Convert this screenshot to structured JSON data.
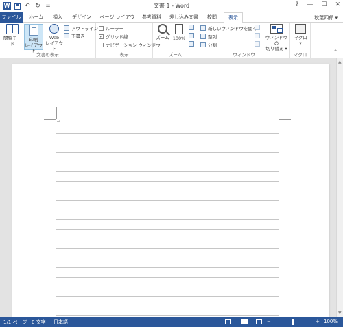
{
  "window": {
    "title": "文書 1 - Word",
    "help": "?",
    "minimize": "—",
    "maximize": "☐",
    "close": "✕",
    "qat_undo": "↶",
    "qat_redo": "↻",
    "qat_customize": "="
  },
  "tabs": {
    "file": "ファイル",
    "home": "ホーム",
    "insert": "挿入",
    "design": "デザイン",
    "layout": "ページ レイアウト",
    "references": "参考資料",
    "mailings": "差し込み文書",
    "review": "校閲",
    "view": "表示",
    "user": "秋葉四郎"
  },
  "ribbon": {
    "views": {
      "label": "文書の表示",
      "read_mode": "閲覧モード",
      "print_layout": "印刷 レイアウト",
      "print_layout_1": "印刷",
      "print_layout_2": "レイアウト",
      "web_layout_1": "Web",
      "web_layout_2": "レイアウト",
      "outline": "アウトライン",
      "draft": "下書き"
    },
    "show": {
      "label": "表示",
      "ruler": "ルーラー",
      "gridlines": "グリッド線",
      "nav_pane": "ナビゲーション ウィンドウ",
      "ruler_checked": false,
      "gridlines_checked": true,
      "nav_pane_checked": false
    },
    "zoom": {
      "label": "ズーム",
      "zoom": "ズーム",
      "hundred": "100%"
    },
    "window": {
      "label": "ウィンドウ",
      "new_window": "新しいウィンドウを開く",
      "arrange": "整列",
      "split": "分割",
      "switch_1": "ウィンドウの",
      "switch_2": "切り替え"
    },
    "macros": {
      "label": "マクロ",
      "macro": "マクロ"
    }
  },
  "document": {
    "paragraph_mark": "↵"
  },
  "status": {
    "page": "1/1 ページ",
    "words": "0 文字",
    "language": "日本語",
    "zoom": "100%",
    "zoom_minus": "−",
    "zoom_plus": "+"
  },
  "colors": {
    "accent": "#2b579a",
    "selected_bg": "#cde6f7"
  }
}
